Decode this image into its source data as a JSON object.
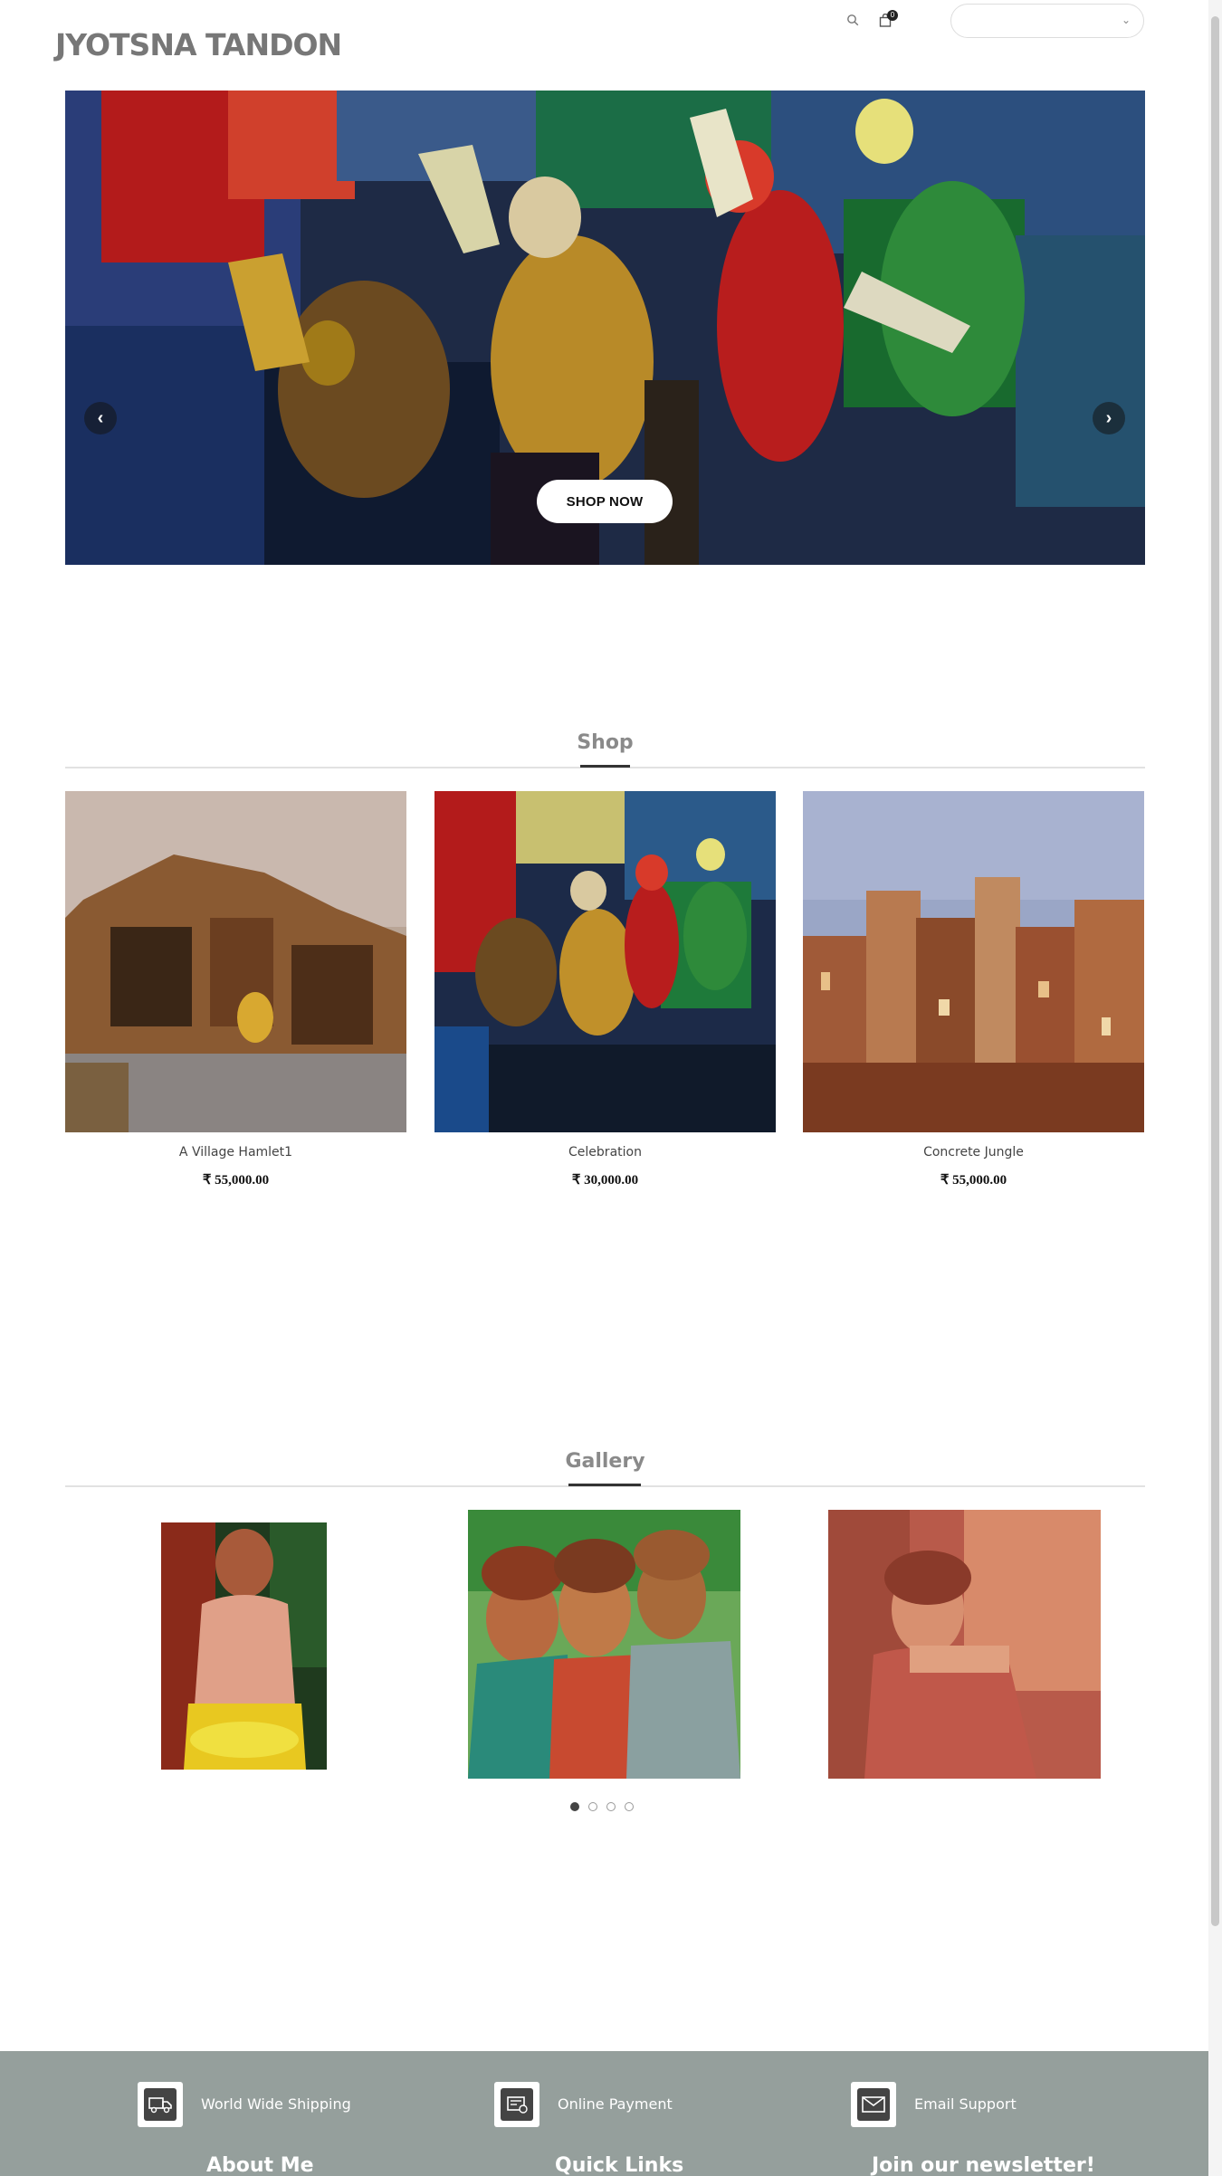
{
  "header": {
    "logo": "JYOTSNA TANDON",
    "cart_count": "0",
    "search_icon": "search-icon",
    "cart_icon": "shopping-bag-icon",
    "select_value": "",
    "select_icon": "chevron-down-icon"
  },
  "hero": {
    "cta_label": "SHOP NOW",
    "prev_icon": "chevron-left-icon",
    "next_icon": "chevron-right-icon"
  },
  "shop": {
    "title": "Shop",
    "products": [
      {
        "name": "A Village Hamlet1",
        "price": "₹ 55,000.00"
      },
      {
        "name": "Celebration",
        "price": "₹ 30,000.00"
      },
      {
        "name": "Concrete Jungle",
        "price": "₹ 55,000.00"
      }
    ]
  },
  "gallery": {
    "title": "Gallery",
    "slide_count": 4,
    "active_slide": 1
  },
  "footer": {
    "features": [
      {
        "label": "World Wide Shipping",
        "icon": "truck-icon"
      },
      {
        "label": "Online Payment",
        "icon": "payment-card-icon"
      },
      {
        "label": "Email Support",
        "icon": "envelope-icon"
      }
    ],
    "columns": [
      {
        "heading": "About Me"
      },
      {
        "heading": "Quick Links"
      },
      {
        "heading": "Join our newsletter!"
      }
    ]
  },
  "colors": {
    "footer_bg": "#959f9c",
    "logo": "#777777",
    "section_title": "#8a8a8a"
  }
}
